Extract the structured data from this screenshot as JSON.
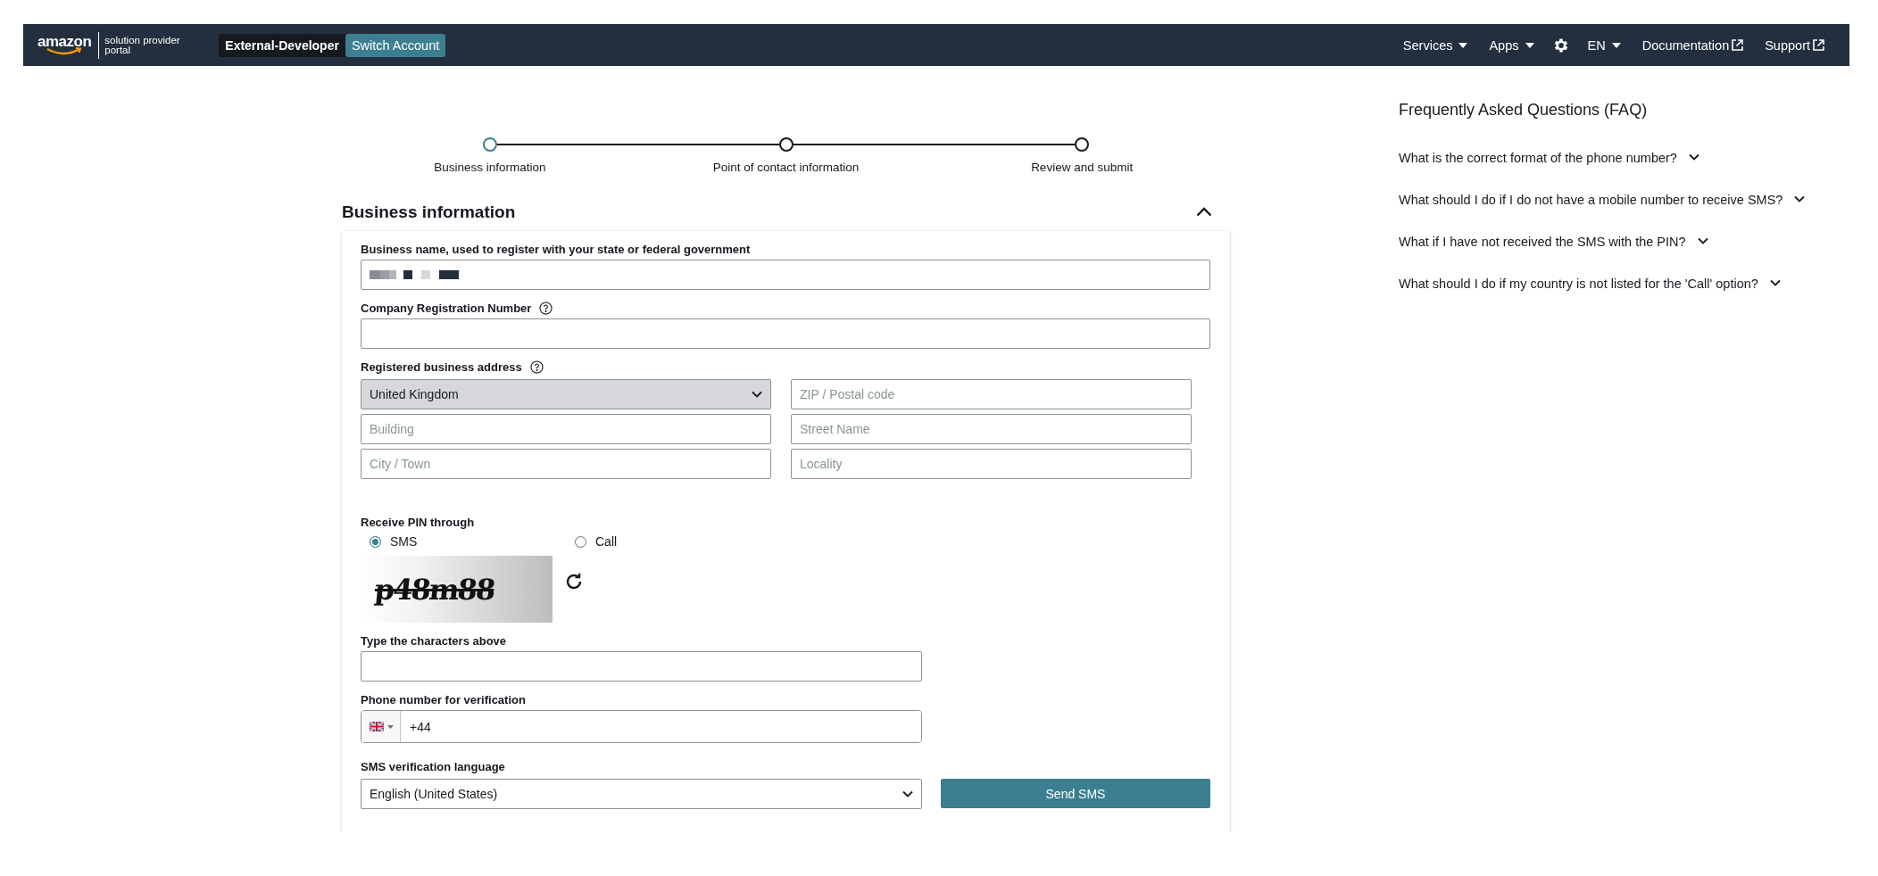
{
  "header": {
    "logo": {
      "wordmark": "amazon",
      "subtitle": "solution provider portal"
    },
    "account": "External-Developer",
    "switch_button": "Switch Account",
    "nav": [
      {
        "label": "Services",
        "kind": "dropdown"
      },
      {
        "label": "Apps",
        "kind": "dropdown"
      },
      {
        "kind": "settings"
      },
      {
        "label": "EN",
        "kind": "dropdown"
      },
      {
        "label": "Documentation",
        "kind": "external"
      },
      {
        "label": "Support",
        "kind": "external"
      }
    ]
  },
  "stepper": [
    {
      "label": "Business information",
      "selected": true
    },
    {
      "label": "Point of contact information",
      "selected": false
    },
    {
      "label": "Review and submit",
      "selected": false
    }
  ],
  "section": {
    "title": "Business information",
    "expanded": true
  },
  "form": {
    "business_name": {
      "label": "Business name, used to register with your state or federal government",
      "redacted": true
    },
    "registration_number": {
      "label": "Company Registration Number",
      "help": true
    },
    "address": {
      "label": "Registered business address",
      "help": true,
      "country": "United Kingdom",
      "fields": [
        {
          "placeholder": "ZIP / Postal code"
        },
        {
          "placeholder": "Building"
        },
        {
          "placeholder": "Street Name"
        },
        {
          "placeholder": "City / Town"
        },
        {
          "placeholder": "Locality"
        }
      ]
    },
    "pin": {
      "label": "Receive PIN through",
      "options": [
        {
          "label": "SMS",
          "selected": true
        },
        {
          "label": "Call",
          "selected": false
        }
      ]
    },
    "captcha": {
      "text": "p48m88"
    },
    "captcha_input": {
      "label": "Type the characters above"
    },
    "phone": {
      "label": "Phone number for verification",
      "value": "+44"
    },
    "language": {
      "label": "SMS verification language",
      "value": "English (United States)"
    },
    "send_button": "Send SMS"
  },
  "faq": {
    "title": "Frequently Asked Questions (FAQ)",
    "items": [
      {
        "question": "What is the correct format of the phone number?",
        "expanded": false
      },
      {
        "question": "What should I do if I do not have a mobile number to receive SMS?",
        "expanded": false
      },
      {
        "question": "What if I have not received the SMS with the PIN?",
        "expanded": false
      },
      {
        "question": "What should I do if my country is not listed for the 'Call' option?",
        "expanded": false
      }
    ]
  }
}
